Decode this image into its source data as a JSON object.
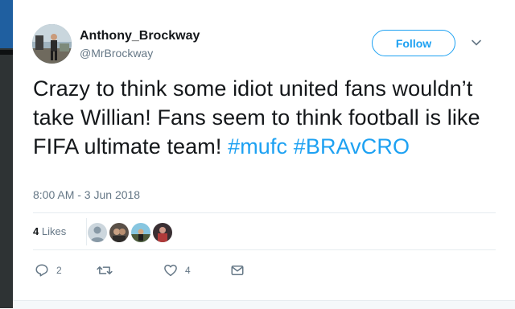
{
  "author": {
    "display_name": "Anthony_Brockway",
    "handle": "@MrBrockway"
  },
  "follow_label": "Follow",
  "tweet": {
    "text_parts": [
      "Crazy to think some idiot united fans wouldn’t take Willian! Fans seem to think football is like FIFA ultimate team! ",
      "#mufc",
      " ",
      "#BRAvCRO"
    ],
    "timestamp": "8:00 AM - 3 Jun 2018"
  },
  "stats": {
    "likes_number": "4",
    "likes_word": "Likes",
    "liker_avatar_count": 4
  },
  "actions": {
    "reply_count": "2",
    "retweet_count": "",
    "like_count": "4"
  },
  "colors": {
    "accent": "#1da1f2",
    "text": "#14171a",
    "secondary": "#657786",
    "divider": "#e6ecf0"
  },
  "icons": [
    "chevron-down-icon",
    "reply-icon",
    "retweet-icon",
    "like-icon",
    "dm-icon"
  ]
}
